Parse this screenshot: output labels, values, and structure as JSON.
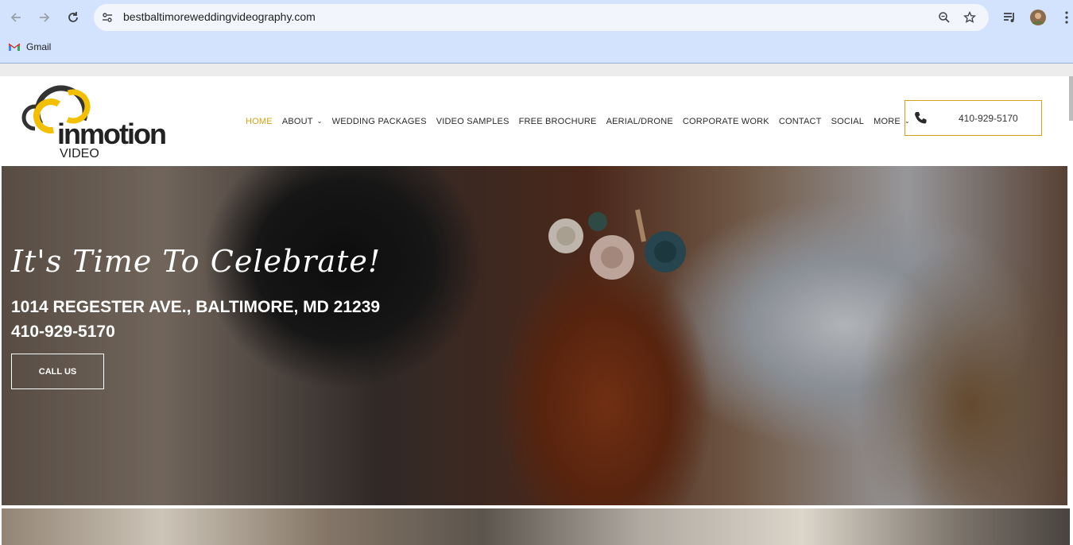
{
  "browser": {
    "url": "bestbaltimoreweddingvideography.com",
    "bookmarks": [
      {
        "label": "Gmail"
      }
    ]
  },
  "site": {
    "logo": {
      "wordmark": "inmotion",
      "sub": "VIDEO"
    },
    "nav": [
      {
        "label": "HOME",
        "active": true,
        "dropdown": false
      },
      {
        "label": "ABOUT",
        "active": false,
        "dropdown": true
      },
      {
        "label": "WEDDING PACKAGES",
        "active": false,
        "dropdown": false
      },
      {
        "label": "VIDEO SAMPLES",
        "active": false,
        "dropdown": false
      },
      {
        "label": "FREE BROCHURE",
        "active": false,
        "dropdown": false
      },
      {
        "label": "AERIAL/DRONE",
        "active": false,
        "dropdown": false
      },
      {
        "label": "CORPORATE WORK",
        "active": false,
        "dropdown": false
      },
      {
        "label": "CONTACT",
        "active": false,
        "dropdown": false
      },
      {
        "label": "SOCIAL",
        "active": false,
        "dropdown": false
      },
      {
        "label": "MORE",
        "active": false,
        "dropdown": true
      }
    ],
    "header_phone": "410-929-5170",
    "accent_color": "#d4a017"
  },
  "hero": {
    "tagline": "It's Time To Celebrate!",
    "address": "1014 REGESTER AVE., BALTIMORE, MD 21239",
    "phone": "410-929-5170",
    "cta_label": "CALL US"
  }
}
